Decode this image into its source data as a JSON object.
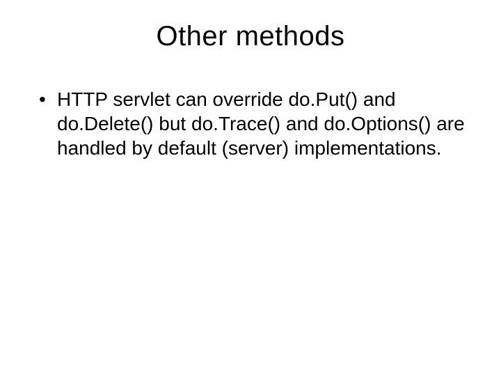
{
  "slide": {
    "title": "Other methods",
    "bullets": [
      "HTTP servlet can override do.Put() and do.Delete() but do.Trace() and do.Options() are handled by default (server) implementations."
    ]
  }
}
